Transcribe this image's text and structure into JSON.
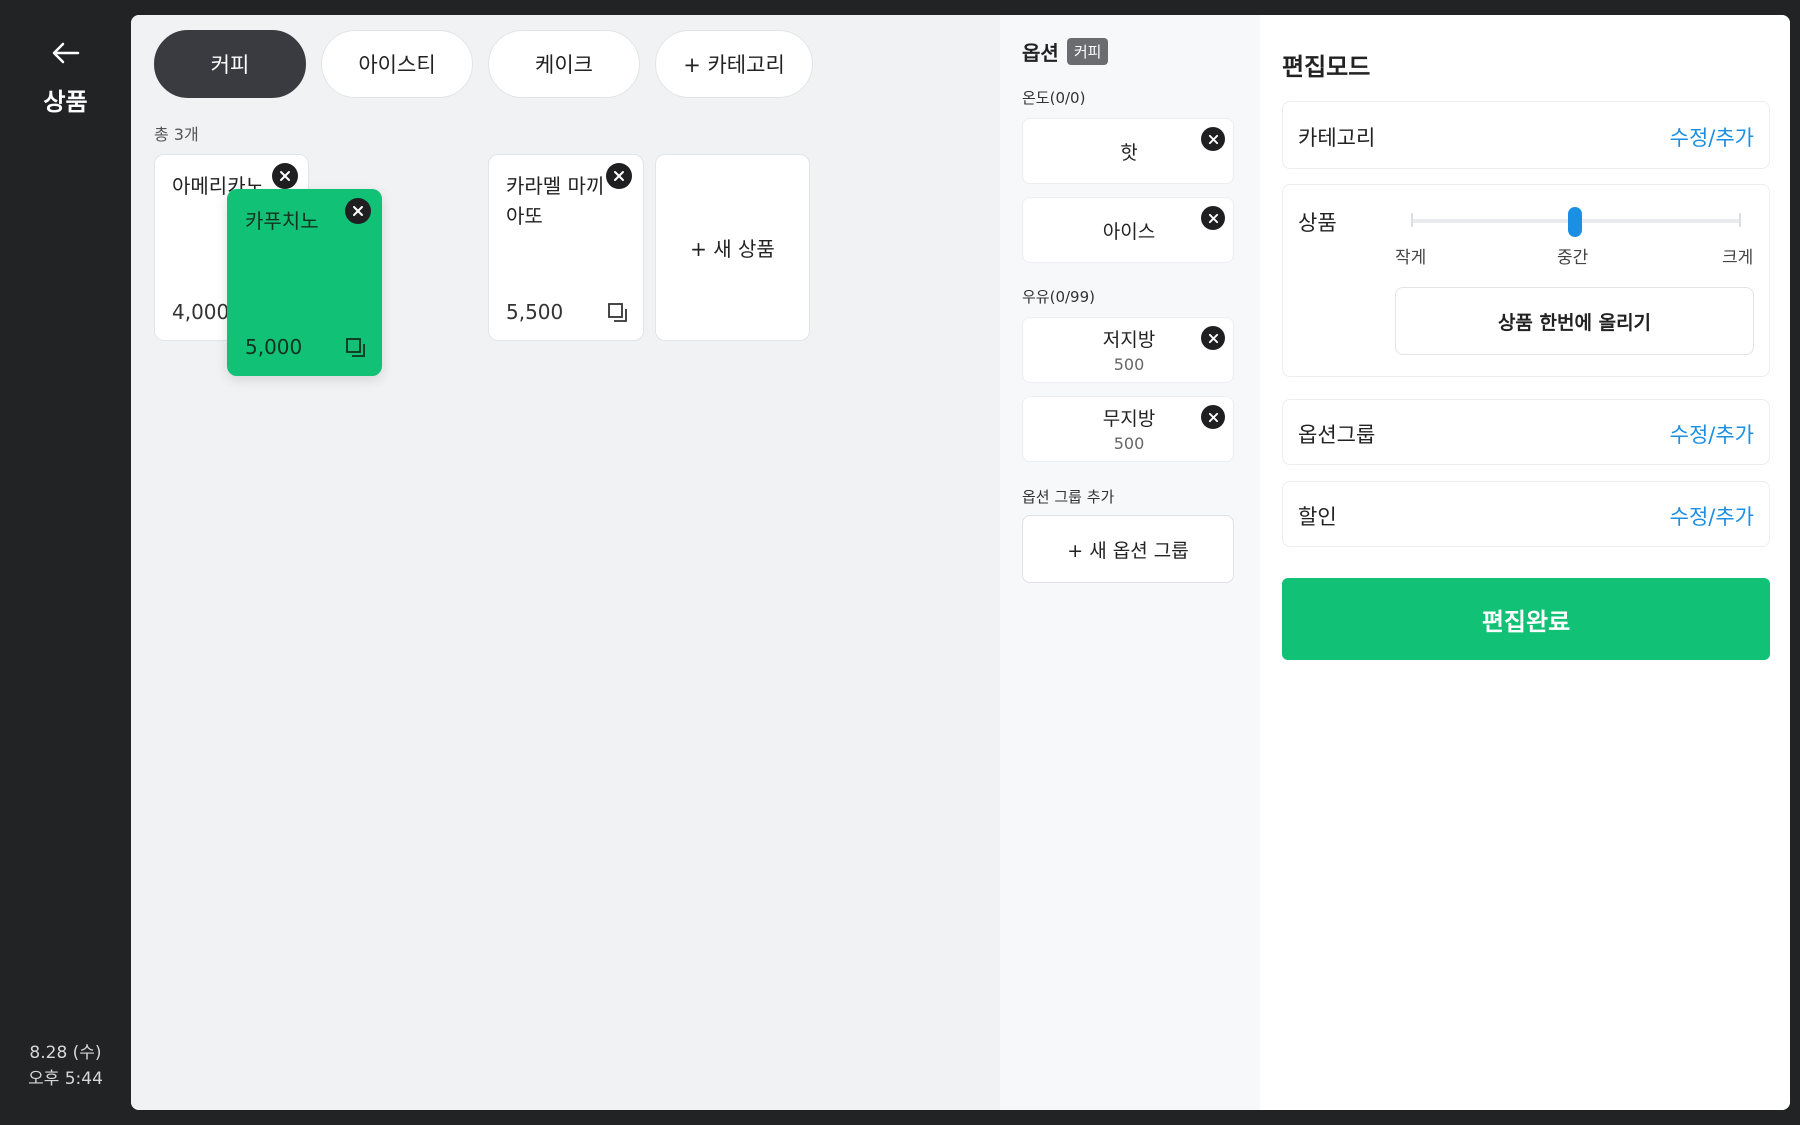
{
  "nav": {
    "title": "상품",
    "date": "8.28 (수)",
    "time": "오후  5:44"
  },
  "tabs": [
    {
      "label": "커피",
      "active": true
    },
    {
      "label": "아이스티",
      "active": false
    },
    {
      "label": "케이크",
      "active": false
    },
    {
      "label": "+ 카테고리",
      "active": false
    }
  ],
  "product_count": "총 3개",
  "products": [
    {
      "name": "아메리카노",
      "price": "4,000"
    },
    {
      "name": "카푸치노",
      "price": "5,000"
    },
    {
      "name": "카라멜 마끼아또",
      "price": "5,500"
    }
  ],
  "new_product_label": "+ 새 상품",
  "options": {
    "title": "옵션",
    "badge": "커피",
    "groups": [
      {
        "label": "온도(0/0)",
        "items": [
          {
            "name": "핫"
          },
          {
            "name": "아이스"
          }
        ]
      },
      {
        "label": "우유(0/99)",
        "items": [
          {
            "name": "저지방",
            "price": "500"
          },
          {
            "name": "무지방",
            "price": "500"
          }
        ]
      }
    ],
    "add_group_label": "옵션 그룹 추가",
    "new_group_button": "+ 새 옵션 그룹"
  },
  "edit": {
    "title": "편집모드",
    "category_label": "카테고리",
    "category_link": "수정/추가",
    "product_label": "상품",
    "size_labels": [
      "작게",
      "중간",
      "크게"
    ],
    "size_selected": "중간",
    "upload_label": "상품 한번에 올리기",
    "option_group_label": "옵션그룹",
    "option_group_link": "수정/추가",
    "discount_label": "할인",
    "discount_link": "수정/추가",
    "done_label": "편집완료"
  },
  "colors": {
    "accent_green": "#10c176",
    "link_blue": "#1a8fe3",
    "dark": "#222325"
  }
}
